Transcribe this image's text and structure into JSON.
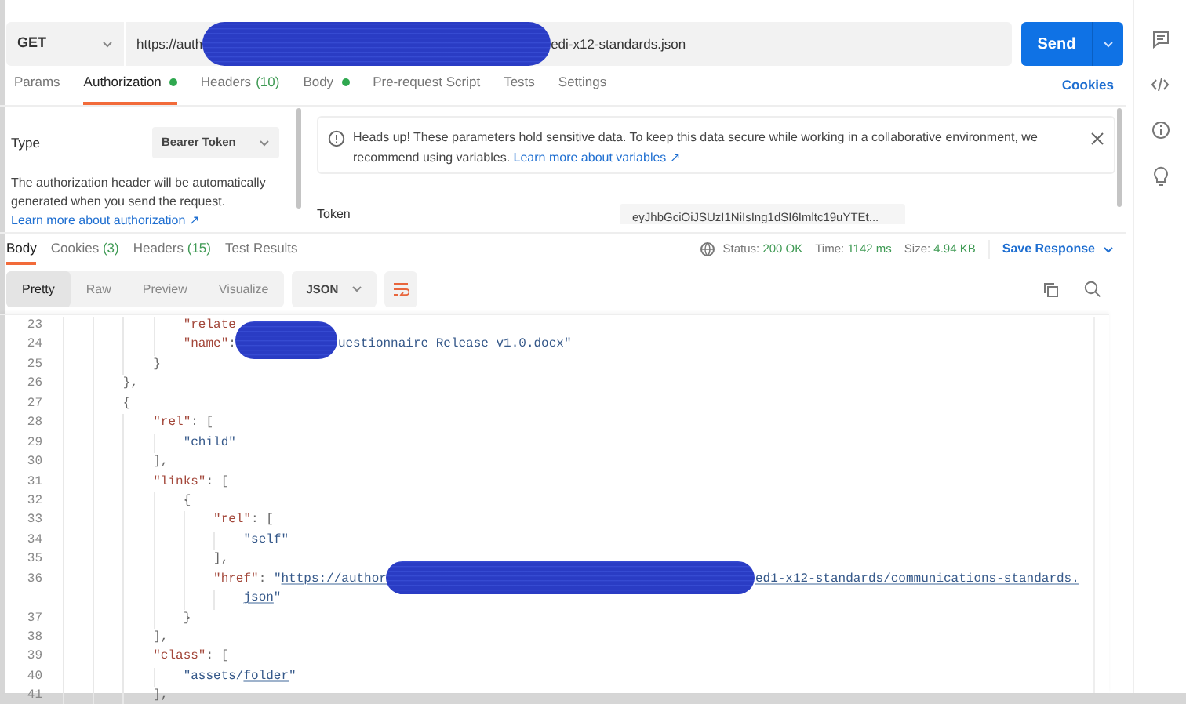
{
  "request": {
    "method": "GET",
    "url_start": "https://auth",
    "url_end": "edi-x12-standards.json",
    "send": "Send"
  },
  "request_tabs": [
    {
      "label": "Params",
      "selected": false,
      "dot": false
    },
    {
      "label": "Authorization",
      "selected": true,
      "dot": true
    },
    {
      "label": "Headers",
      "count": "(10)",
      "selected": false,
      "dot": false
    },
    {
      "label": "Body",
      "selected": false,
      "dot": true
    },
    {
      "label": "Pre-request Script",
      "selected": false,
      "dot": false
    },
    {
      "label": "Tests",
      "selected": false,
      "dot": false
    },
    {
      "label": "Settings",
      "selected": false,
      "dot": false
    }
  ],
  "cookies_link": "Cookies",
  "auth": {
    "type_label": "Type",
    "type_value": "Bearer Token",
    "description": "The authorization header will be automatically generated when you send the request.",
    "learn_more": "Learn more about authorization ↗",
    "notice": "Heads up! These parameters hold sensitive data. To keep this data secure while working in a collaborative environment, we recommend using variables.",
    "notice_link": "Learn more about variables ↗",
    "token_label": "Token",
    "token_value": "eyJhbGciOiJSUzI1NiIsIng1dSI6Imltc19uYTEt..."
  },
  "response_tabs": [
    {
      "label": "Body",
      "selected": true
    },
    {
      "label": "Cookies",
      "count": "(3)",
      "selected": false
    },
    {
      "label": "Headers",
      "count": "(15)",
      "selected": false
    },
    {
      "label": "Test Results",
      "selected": false
    }
  ],
  "status": {
    "status_label": "Status:",
    "status": "200 OK",
    "time_label": "Time:",
    "time": "1142 ms",
    "size_label": "Size:",
    "size": "4.94 KB",
    "save": "Save Response"
  },
  "view_modes": [
    {
      "label": "Pretty",
      "selected": true
    },
    {
      "label": "Raw",
      "selected": false
    },
    {
      "label": "Preview",
      "selected": false
    },
    {
      "label": "Visualize",
      "selected": false
    }
  ],
  "format": "JSON",
  "code_lines": [
    {
      "number": "23",
      "tokens": [
        {
          "kind": "key",
          "text": "                \"relate"
        }
      ]
    },
    {
      "number": "24",
      "tokens": [
        {
          "kind": "key",
          "text": "                \"name\""
        },
        {
          "kind": "punct",
          "text": ":"
        },
        {
          "kind": "redaction"
        },
        {
          "kind": "str",
          "text": "uestionnaire Release v1.0.docx\""
        }
      ]
    },
    {
      "number": "25",
      "tokens": [
        {
          "kind": "punct",
          "text": "            }"
        }
      ]
    },
    {
      "number": "26",
      "tokens": [
        {
          "kind": "punct",
          "text": "        },"
        }
      ]
    },
    {
      "number": "27",
      "tokens": [
        {
          "kind": "punct",
          "text": "        {"
        }
      ]
    },
    {
      "number": "28",
      "tokens": [
        {
          "kind": "key",
          "text": "            \"rel\""
        },
        {
          "kind": "punct",
          "text": ": ["
        }
      ]
    },
    {
      "number": "29",
      "tokens": [
        {
          "kind": "str",
          "text": "                \"child\""
        }
      ]
    },
    {
      "number": "30",
      "tokens": [
        {
          "kind": "punct",
          "text": "            ],"
        }
      ]
    },
    {
      "number": "31",
      "tokens": [
        {
          "kind": "key",
          "text": "            \"links\""
        },
        {
          "kind": "punct",
          "text": ": ["
        }
      ]
    },
    {
      "number": "32",
      "tokens": [
        {
          "kind": "punct",
          "text": "                {"
        }
      ]
    },
    {
      "number": "33",
      "tokens": [
        {
          "kind": "key",
          "text": "                    \"rel\""
        },
        {
          "kind": "punct",
          "text": ": ["
        }
      ]
    },
    {
      "number": "34",
      "tokens": [
        {
          "kind": "str",
          "text": "                        \"self\""
        }
      ]
    },
    {
      "number": "35",
      "tokens": [
        {
          "kind": "punct",
          "text": "                    ],"
        }
      ]
    },
    {
      "number": "36",
      "tokens": [
        {
          "kind": "key",
          "text": "                    \"href\""
        },
        {
          "kind": "punct",
          "text": ": "
        },
        {
          "kind": "str",
          "text": "\""
        },
        {
          "kind": "link",
          "text": "https://author"
        },
        {
          "kind": "redaction"
        },
        {
          "kind": "link",
          "text": "ed1-x12-standards/communications-standards."
        }
      ]
    },
    {
      "tokens": [
        {
          "kind": "link",
          "text": "                        json"
        },
        {
          "kind": "str",
          "text": "\""
        }
      ]
    },
    {
      "number": "37",
      "tokens": [
        {
          "kind": "punct",
          "text": "                }"
        }
      ]
    },
    {
      "number": "38",
      "tokens": [
        {
          "kind": "punct",
          "text": "            ],"
        }
      ]
    },
    {
      "number": "39",
      "tokens": [
        {
          "kind": "key",
          "text": "            \"class\""
        },
        {
          "kind": "punct",
          "text": ": ["
        }
      ]
    },
    {
      "number": "40",
      "tokens": [
        {
          "kind": "str",
          "text": "                \"assets/"
        },
        {
          "kind": "link",
          "text": "folder"
        },
        {
          "kind": "str",
          "text": "\""
        }
      ]
    },
    {
      "number": "41",
      "tokens": [
        {
          "kind": "punct",
          "text": "            ],"
        }
      ]
    }
  ]
}
